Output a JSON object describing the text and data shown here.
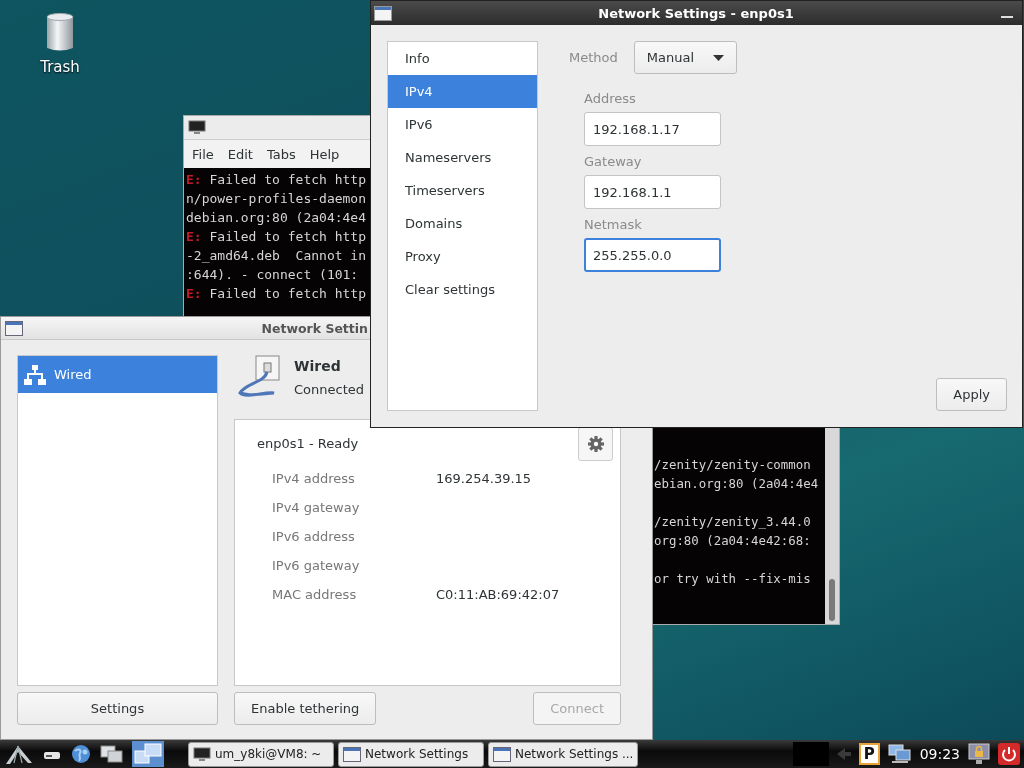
{
  "desktop": {
    "icons": [
      {
        "label": "Trash"
      }
    ]
  },
  "terminal": {
    "menu": [
      "File",
      "Edit",
      "Tabs",
      "Help"
    ],
    "lines_top": [
      {
        "kind": "error",
        "mark": "E:",
        "text": "Failed to fetch http"
      },
      {
        "kind": "plain",
        "text": "n/power-profiles-daemon"
      },
      {
        "kind": "plain",
        "text": "debian.org:80 (2a04:4e4"
      },
      {
        "kind": "error",
        "mark": "E:",
        "text": "Failed to fetch http"
      },
      {
        "kind": "plain",
        "text": "-2_amd64.deb  Cannot in"
      },
      {
        "kind": "plain",
        "text": ":644). - connect (101:"
      },
      {
        "kind": "error",
        "mark": "E:",
        "text": "Failed to fetch http"
      }
    ],
    "lines_bottom": [
      {
        "kind": "plain",
        "text": "/zenity/zenity-common"
      },
      {
        "kind": "plain",
        "text": "ebian.org:80 (2a04:4e4"
      },
      {
        "kind": "blank"
      },
      {
        "kind": "plain",
        "text": "/zenity/zenity_3.44.0"
      },
      {
        "kind": "plain",
        "text": "org:80 (2a04:4e42:68:"
      },
      {
        "kind": "blank"
      },
      {
        "kind": "plain",
        "text": "or try with --fix-mis"
      }
    ]
  },
  "network_window": {
    "title": "Network Settin",
    "devices": [
      {
        "label": "Wired",
        "selected": true
      }
    ],
    "device": {
      "name": "Wired",
      "status": "Connected"
    },
    "details": {
      "title": "enp0s1 - Ready",
      "rows": [
        {
          "label": "IPv4 address",
          "value": "169.254.39.15"
        },
        {
          "label": "IPv4 gateway"
        },
        {
          "label": "IPv6 address"
        },
        {
          "label": "IPv6 gateway"
        },
        {
          "label": "MAC address",
          "value": "C0:11:AB:69:42:07"
        }
      ]
    },
    "buttons": [
      {
        "label": "Settings",
        "disabled": false
      },
      {
        "label": "Enable tethering",
        "disabled": false
      },
      {
        "label": "Connect",
        "disabled": true
      }
    ]
  },
  "dialog": {
    "title": "Network Settings - enp0s1",
    "sections": [
      {
        "label": "Info",
        "selected": false
      },
      {
        "label": "IPv4",
        "selected": true
      },
      {
        "label": "IPv6",
        "selected": false
      },
      {
        "label": "Nameservers",
        "selected": false
      },
      {
        "label": "Timeservers",
        "selected": false
      },
      {
        "label": "Domains",
        "selected": false
      },
      {
        "label": "Proxy",
        "selected": false
      },
      {
        "label": "Clear settings",
        "selected": false
      }
    ],
    "method": {
      "label": "Method",
      "value": "Manual"
    },
    "fields": [
      {
        "label": "Address",
        "value": "192.168.1.17",
        "focused": false
      },
      {
        "label": "Gateway",
        "value": "192.168.1.1",
        "focused": false
      },
      {
        "label": "Netmask",
        "value": "255.255.0.0",
        "focused": true
      }
    ],
    "apply": "Apply"
  },
  "taskbar": {
    "tasks": [
      {
        "kind": "terminal",
        "label": "um_y8ki@VM8: ~"
      },
      {
        "kind": "window",
        "label": "Network Settings"
      },
      {
        "kind": "window",
        "label": "Network Settings ..."
      }
    ],
    "tray_badge": "P",
    "clock": "09:23"
  }
}
